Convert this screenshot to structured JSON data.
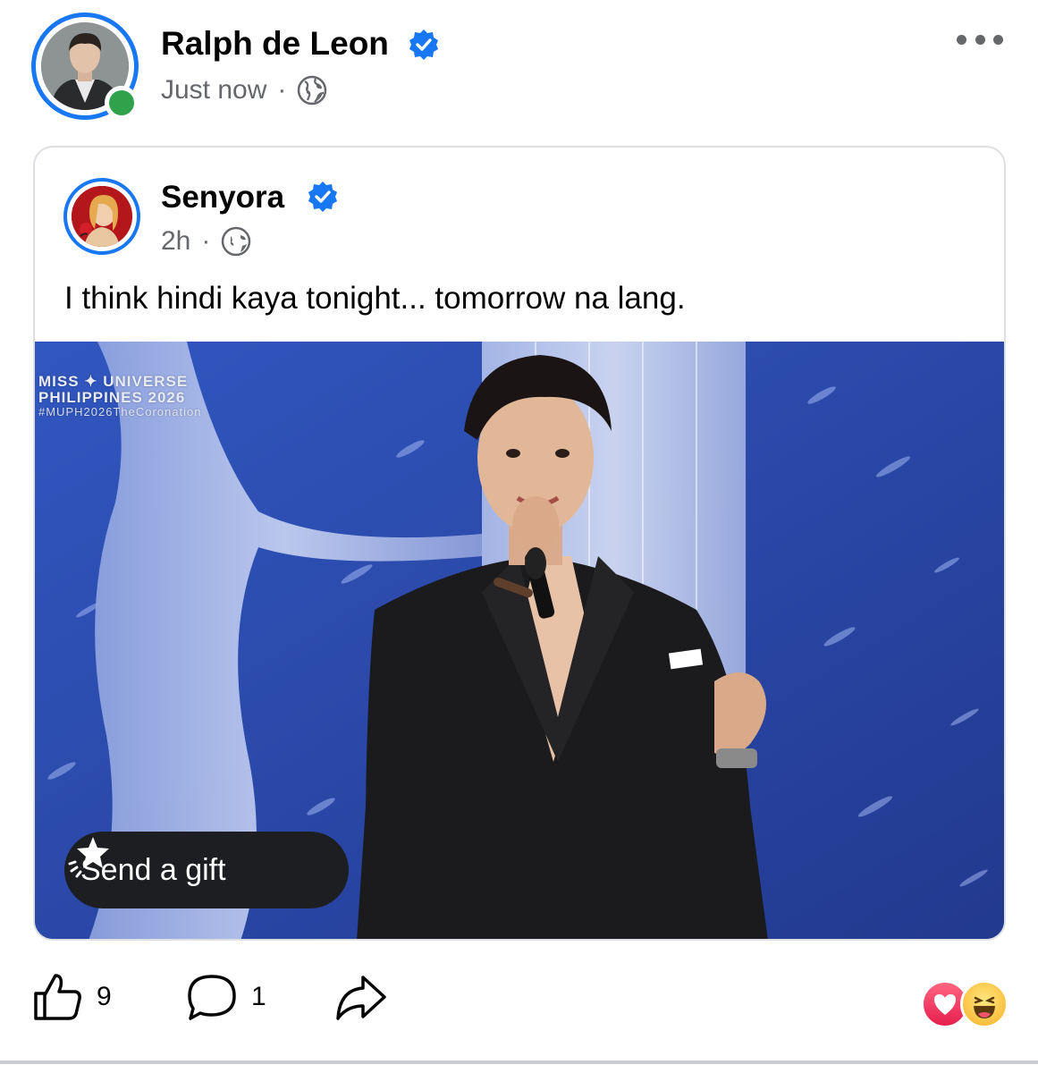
{
  "post": {
    "author": "Ralph de Leon",
    "timestamp": "Just now",
    "separator": "·",
    "audience_icon": "globe-icon",
    "verified_icon": "verified-badge-icon",
    "more_icon": "more-options-icon"
  },
  "shared_post": {
    "author": "Senyora",
    "timestamp": "2h",
    "separator": "·",
    "audience_icon": "globe-icon",
    "text": "I think hindi kaya tonight... tomorrow na lang.",
    "media": {
      "watermark_line1": "MISS ✦ UNIVERSE",
      "watermark_line2": "PHILIPPINES 2026",
      "watermark_line3": "#MUPH2026TheCoronation"
    },
    "gift_button": {
      "label": "Send a gift",
      "icon": "gift-star-icon"
    }
  },
  "actions": {
    "like_count": "9",
    "comment_count": "1",
    "like_icon": "thumbs-up-icon",
    "comment_icon": "comment-icon",
    "share_icon": "share-icon",
    "reactions": [
      "love",
      "haha"
    ]
  },
  "colors": {
    "brand_blue": "#1877f2",
    "online_green": "#31a24c",
    "secondary_text": "#65676b",
    "love_red": "#e61e4d",
    "haha_yellow": "#f7b125"
  }
}
